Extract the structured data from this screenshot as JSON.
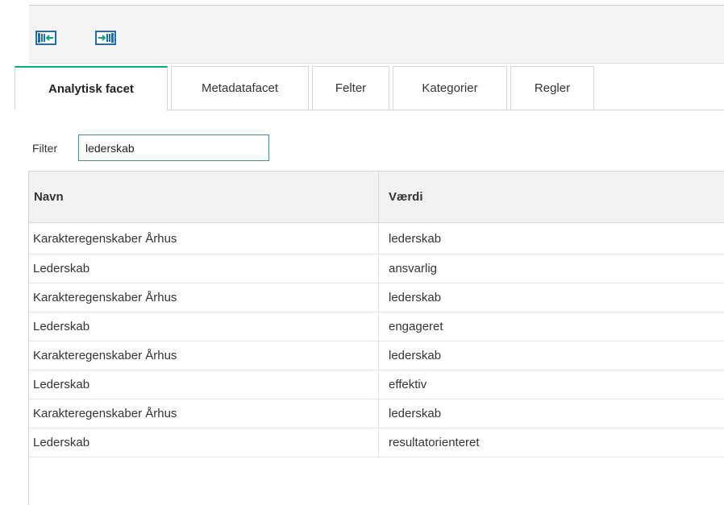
{
  "toolbar": {
    "buttons": [
      {
        "icon": "collapse-panel-left-icon"
      },
      {
        "icon": "expand-panel-right-icon"
      }
    ],
    "accent": "#1c6fb0"
  },
  "tabs": [
    {
      "label": "Analytisk facet",
      "active": true
    },
    {
      "label": "Metadatafacet",
      "active": false
    },
    {
      "label": "Felter",
      "active": false
    },
    {
      "label": "Kategorier",
      "active": false
    },
    {
      "label": "Regler",
      "active": false
    }
  ],
  "active_tab_color": "#01a982",
  "filter": {
    "label": "Filter",
    "value": "lederskab"
  },
  "grid": {
    "columns": [
      "Navn",
      "Værdi"
    ],
    "rows": [
      {
        "navn": "Karakteregenskaber Århus",
        "vaerdi": "lederskab"
      },
      {
        "navn": "Lederskab",
        "vaerdi": "ansvarlig"
      },
      {
        "navn": "Karakteregenskaber Århus",
        "vaerdi": "lederskab"
      },
      {
        "navn": "Lederskab",
        "vaerdi": "engageret"
      },
      {
        "navn": "Karakteregenskaber Århus",
        "vaerdi": "lederskab"
      },
      {
        "navn": "Lederskab",
        "vaerdi": "effektiv"
      },
      {
        "navn": "Karakteregenskaber Århus",
        "vaerdi": "lederskab"
      },
      {
        "navn": "Lederskab",
        "vaerdi": "resultatorienteret"
      }
    ]
  }
}
